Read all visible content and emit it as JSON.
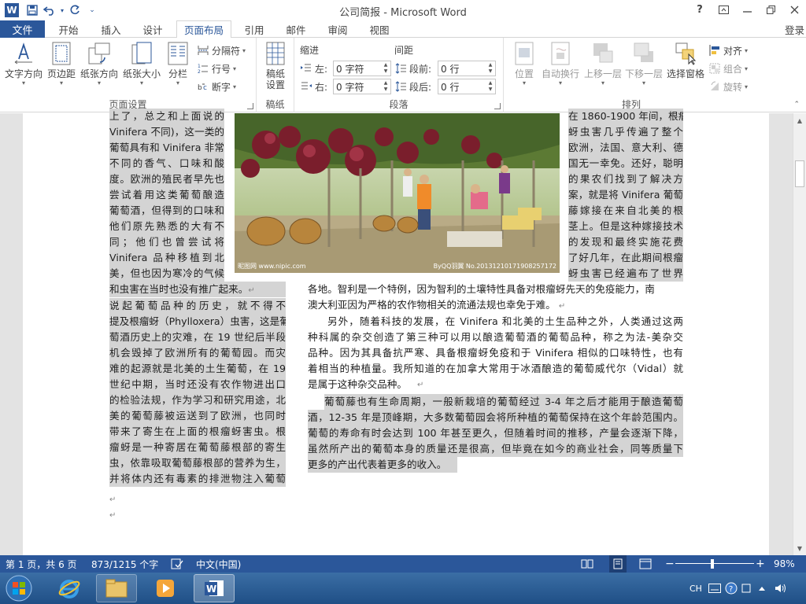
{
  "titlebar": {
    "title": "公司简报 - Microsoft Word",
    "help_icon": "?",
    "app_icon": "W"
  },
  "tabs": {
    "file": "文件",
    "items": [
      "开始",
      "插入",
      "设计",
      "页面布局",
      "引用",
      "邮件",
      "审阅",
      "视图"
    ],
    "active": "页面布局",
    "login": "登录"
  },
  "ribbon": {
    "page_setup": {
      "label": "页面设置",
      "text_direction": "文字方向",
      "margins": "页边距",
      "orientation": "纸张方向",
      "size": "纸张大小",
      "columns": "分栏",
      "breaks": "分隔符",
      "line_numbers": "行号",
      "hyphenation": "断字"
    },
    "draft": {
      "label": "稿纸",
      "draft_settings": "稿纸设置"
    },
    "paragraph": {
      "label": "段落",
      "indent_title": "缩进",
      "spacing_title": "间距",
      "left_label": "左:",
      "left_value": "0 字符",
      "right_label": "右:",
      "right_value": "0 字符",
      "before_label": "段前:",
      "before_value": "0 行",
      "after_label": "段后:",
      "after_value": "0 行"
    },
    "arrange": {
      "label": "排列",
      "position": "位置",
      "wrap_text": "自动换行",
      "bring_forward": "上移一层",
      "send_backward": "下移一层",
      "selection_pane": "选择窗格",
      "align": "对齐",
      "group": "组合",
      "rotate": "旋转"
    }
  },
  "document": {
    "col1": [
      "上了，总之和上面说的",
      "Vinifera 不同)，这一类的",
      "葡萄具有和 Vinifera 非常",
      "不同的香气、口味和酸",
      "度。欧洲的殖民者早先也",
      "尝试着用这类葡萄酿造",
      "葡萄酒，但得到的口味和",
      "他们原先熟悉的大有不",
      "同；他们也曾尝试将",
      "Vinifera 品种移植到北",
      "美，但也因为寒冷的气候"
    ],
    "col1_tail": "和虫害在当时也没有推广起来。",
    "col3": [
      "在 1860-1900 年间，根瘤",
      "蚜虫害几乎传遍了整个",
      "欧洲，法国、意大利、德",
      "国无一幸免。还好，聪明",
      "的果农们找到了解决方",
      "案，就是将 Vinifera 葡萄",
      "藤嫁接在来自北美的根",
      "茎上。但是这种嫁接技术",
      "的发现和最终实施花费",
      "了好几年，在此期间根瘤",
      "蚜虫害已经遍布了世界"
    ],
    "wide_line_1": "各地。智利是一个特例，因为智利的土壤特性具备对根瘤蚜先天的免疫能力，南",
    "wide_line_2": "澳大利亚因为严格的农作物相关的流通法规也幸免于难。",
    "left_col": [
      "说起葡萄品种的历史，就不得不",
      "提及根瘤蚜（Phylloxera）虫害，这是葡",
      "萄酒历史上的灾难，在 19 世纪后半段",
      "机会毁掉了欧洲所有的葡萄园。而灾",
      "难的起源就是北美的土生葡萄，在 19",
      "世纪中期，当时还没有农作物进出口",
      "的检验法规，作为学习和研究用途，北",
      "美的葡萄藤被运送到了欧洲，也同时",
      "带来了寄生在上面的根瘤蚜害虫。根",
      "瘤蚜是一种寄居在葡萄藤根部的寄生",
      "虫，依靠吸取葡萄藤根部的营养为生，",
      "并将体内还有毒素的排泄物注入葡萄"
    ],
    "right_col_p1": [
      "另外，随着科技的发展，在 Vinifera 和北美的土生品种之外，人类通过这两",
      "种科属的杂交创造了第三种可以用以酿造葡萄酒的葡萄品种，称之为法-美杂交",
      "品种。因为其具备抗严寒、具备根瘤蚜免疫和于 Vinifera 相似的口味特性，也有",
      "着相当的种植量。我所知道的在加拿大常用于冰酒酿造的葡萄威代尔（Vidal）就",
      "是属于这种杂交品种。"
    ],
    "right_col_p2": [
      "葡萄藤也有生命周期，一般新栽培的葡萄经过 3-4 年之后才能用于酿造葡萄",
      "酒，12-35 年是顶峰期，大多数葡萄园会将所种植的葡萄保持在这个年龄范围内。",
      "葡萄的寿命有时会达到 100 年甚至更久，但随着时间的推移，产量会逐渐下降，",
      "虽然所产出的葡萄本身的质量还是很高，但毕竟在如今的商业社会，同等质量下",
      "更多的产出代表着更多的收入。"
    ],
    "para_mark": "↵",
    "photo_credit_left": "昵图网 www.nipic.com",
    "photo_credit_right": "ByQQ羽翼 No.20131210171908257172"
  },
  "statusbar": {
    "page": "第 1 页，共 6 页",
    "words": "873/1215 个字",
    "language": "中文(中国)",
    "zoom": "98%",
    "zoom_minus": "−",
    "zoom_plus": "+"
  },
  "taskbar": {
    "ime": "CH"
  },
  "colors": {
    "accent": "#2b579a",
    "highlight": "#d4d4d4"
  }
}
